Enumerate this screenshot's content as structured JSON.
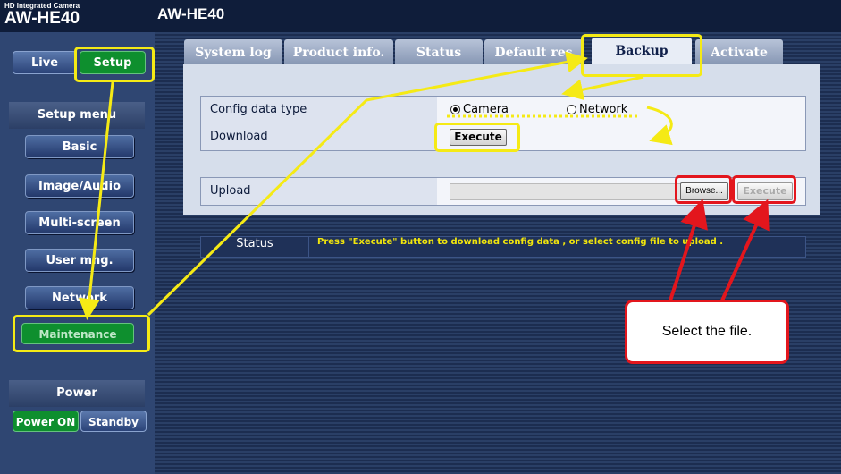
{
  "header": {
    "brand_small": "HD Integrated Camera",
    "brand_model": "AW-HE40",
    "page_model": "AW-HE40"
  },
  "sidebar": {
    "live_label": "Live",
    "setup_label": "Setup",
    "setup_menu_heading": "Setup menu",
    "menu_items": [
      "Basic",
      "Image/Audio",
      "Multi-screen",
      "User mng.",
      "Network",
      "Maintenance"
    ],
    "power_heading": "Power",
    "power_on_label": "Power ON",
    "standby_label": "Standby"
  },
  "tabs": [
    "System log",
    "Product info.",
    "Status",
    "Default res",
    "Backup",
    "Activate"
  ],
  "backup": {
    "config_type_label": "Config data type",
    "radio_camera": "Camera",
    "radio_network": "Network",
    "download_label": "Download",
    "execute_label": "Execute",
    "upload_label": "Upload",
    "browse_label": "Browse...",
    "upload_execute_label": "Execute"
  },
  "status": {
    "label": "Status",
    "message": "Press \"Execute\" button to download config data , or select config file to upload ."
  },
  "annotation": {
    "callout_text": "Select the file."
  },
  "colors": {
    "highlight_yellow": "#f5ea15",
    "highlight_red": "#e3161d",
    "status_text": "#f2e60c",
    "active_green": "#0e8f2e"
  }
}
